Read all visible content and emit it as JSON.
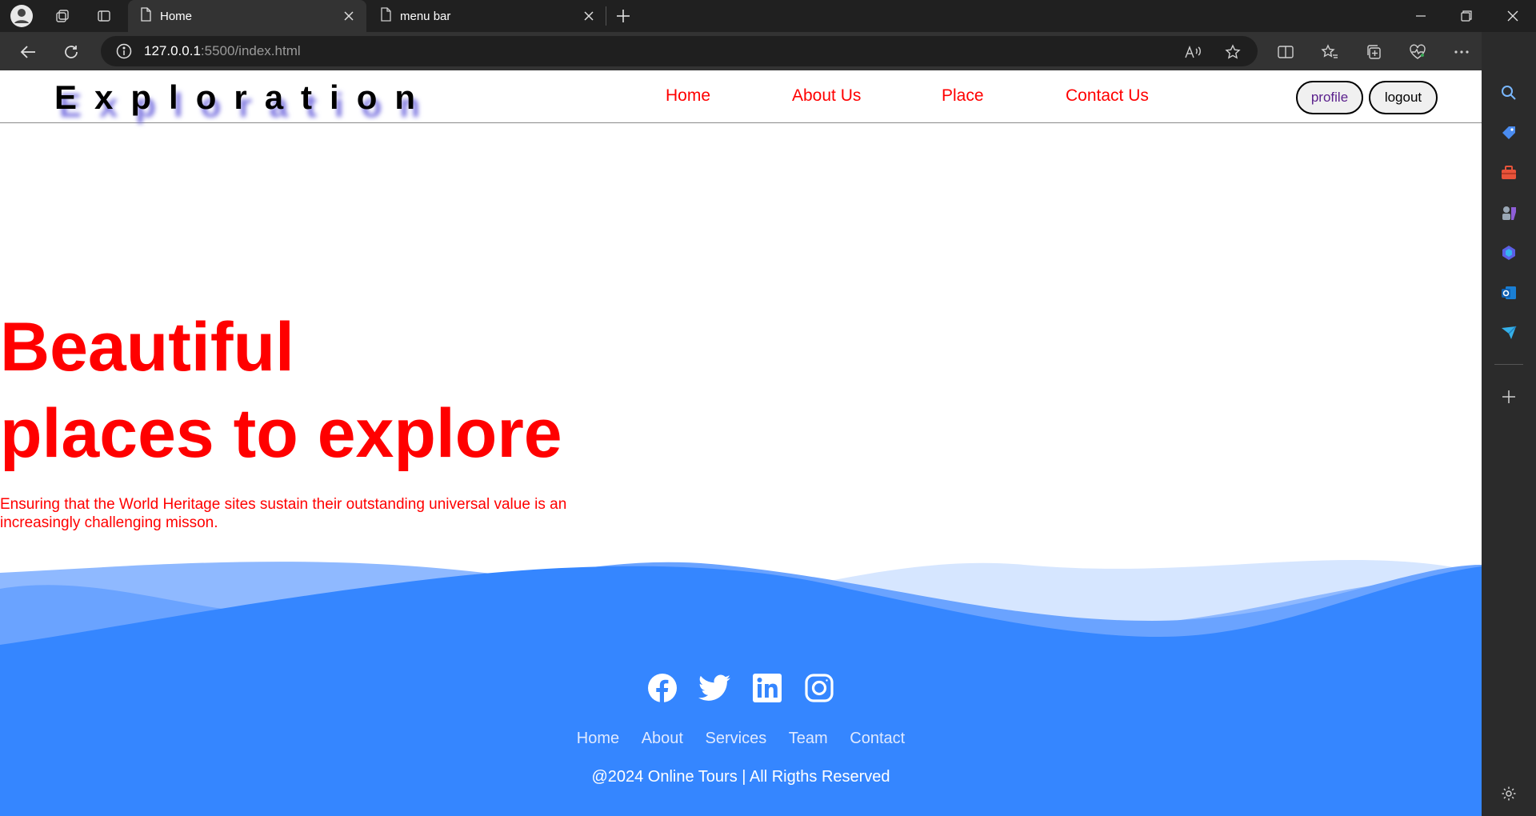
{
  "browser": {
    "tabs": [
      {
        "title": "Home"
      },
      {
        "title": "menu bar"
      }
    ],
    "url_host": "127.0.0.1",
    "url_path": ":5500/index.html"
  },
  "site": {
    "logo": "Exploration",
    "nav": [
      "Home",
      "About Us",
      "Place",
      "Contact Us"
    ],
    "profile_label": "profile",
    "logout_label": "logout"
  },
  "hero": {
    "title_line1": "Beautiful",
    "title_line2": "places to explore",
    "text": "Ensuring that the World Heritage sites sustain their outstanding universal value is an increasingly challenging misson."
  },
  "footer": {
    "social_icons": [
      "facebook-icon",
      "twitter-icon",
      "linkedin-icon",
      "instagram-icon"
    ],
    "links": [
      "Home",
      "About",
      "Services",
      "Team",
      "Contact"
    ],
    "copyright": "@2024 Online Tours | All Rigths Reserved"
  },
  "colors": {
    "accent_red": "#ff0000",
    "footer_blue": "#3586ff"
  }
}
